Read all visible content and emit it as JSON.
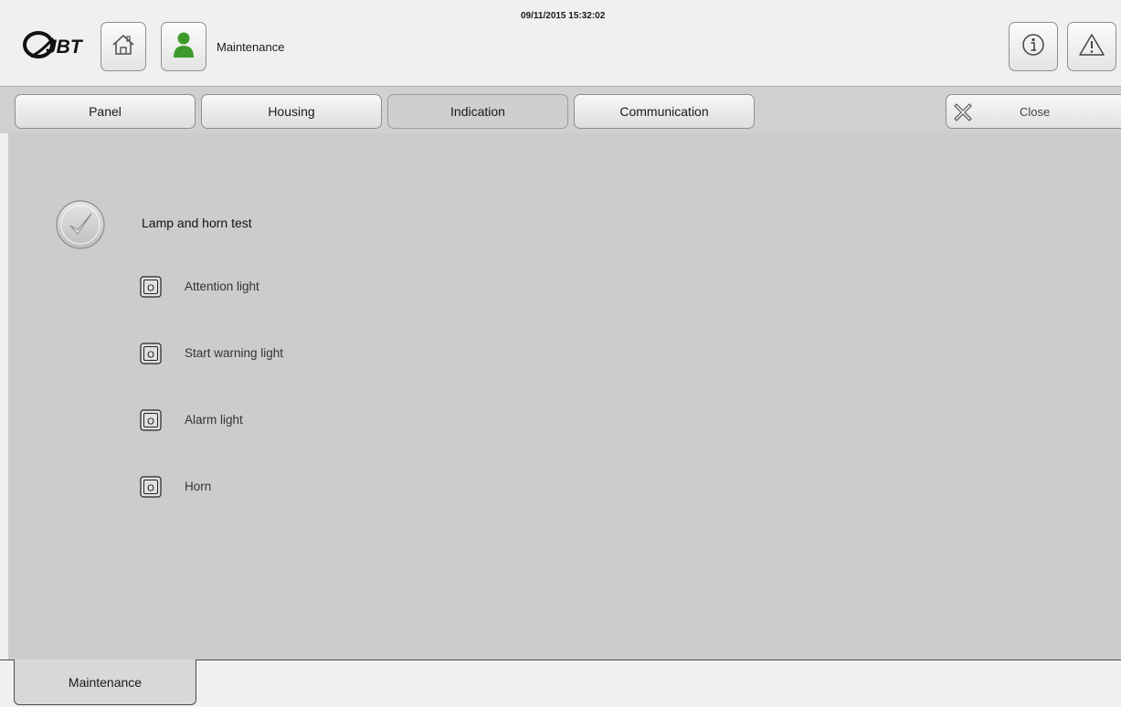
{
  "header": {
    "logo_text": "JBT",
    "screen_title": "Maintenance",
    "datetime": "09/11/2015 15:32:02",
    "icons": {
      "home": "home-icon",
      "user": "user-icon",
      "info": "info-icon",
      "alarm": "warning-icon"
    },
    "colors": {
      "user_icon": "#3d9a2a"
    }
  },
  "tabs": [
    {
      "label": "Panel",
      "active": false
    },
    {
      "label": "Housing",
      "active": false
    },
    {
      "label": "Indication",
      "active": true
    },
    {
      "label": "Communication",
      "active": false
    }
  ],
  "close": {
    "label": "Close",
    "icon": "close-icon"
  },
  "main": {
    "test": {
      "label": "Lamp and horn test",
      "icon": "checkmark-icon"
    },
    "outputs": [
      {
        "label": "Attention light",
        "indicator": "O"
      },
      {
        "label": "Start warning light",
        "indicator": "O"
      },
      {
        "label": "Alarm light",
        "indicator": "O"
      },
      {
        "label": "Horn",
        "indicator": "O"
      }
    ]
  },
  "footer": {
    "tab_label": "Maintenance"
  }
}
